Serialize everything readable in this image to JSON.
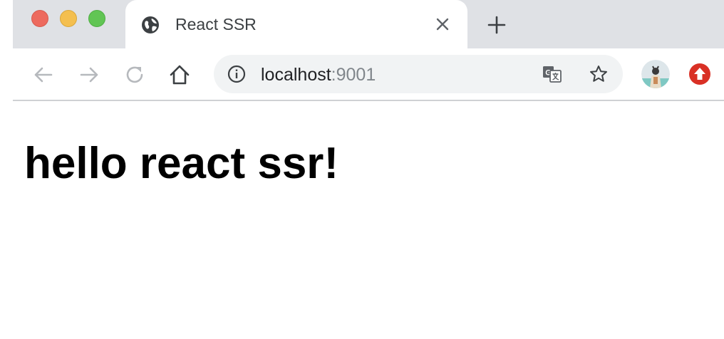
{
  "tab": {
    "title": "React SSR",
    "favicon": "globe-icon"
  },
  "toolbar": {
    "back": "arrow-left-icon",
    "forward": "arrow-right-icon",
    "reload": "reload-icon",
    "home": "home-icon"
  },
  "omnibox": {
    "url_host": "localhost",
    "url_port": ":9001",
    "site_info": "info-icon",
    "translate": "translate-icon",
    "bookmark": "star-icon"
  },
  "page": {
    "heading": "hello react ssr!"
  },
  "colors": {
    "tabstrip": "#dfe1e5",
    "omnibox": "#f1f3f4",
    "close_light": "#ed6a5e",
    "minimize_light": "#f4bf4f",
    "maximize_light": "#61c554",
    "extension_red": "#d93025"
  }
}
